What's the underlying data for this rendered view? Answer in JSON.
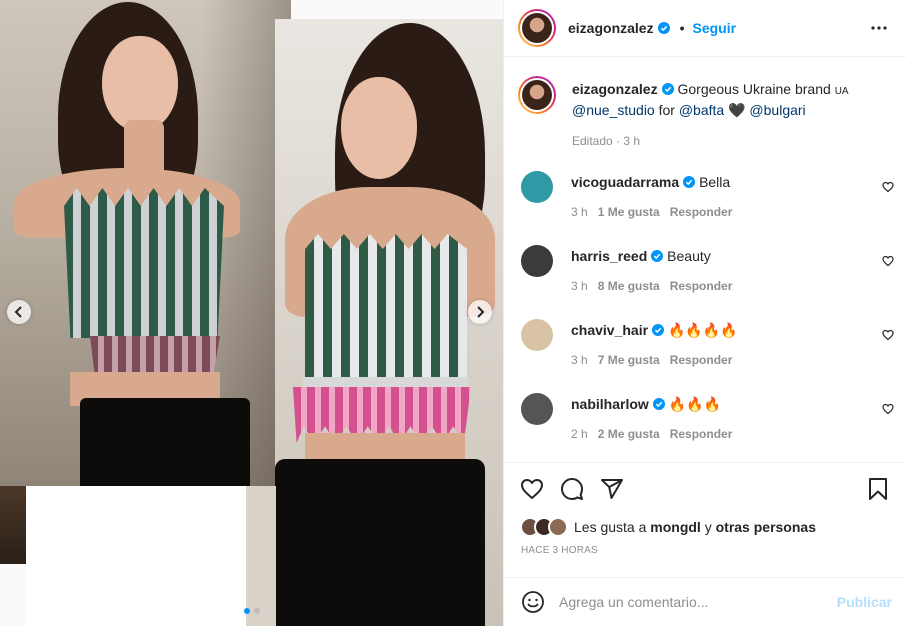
{
  "post": {
    "author": "eizagonzalez",
    "follow_label": "Seguir",
    "separator": "•",
    "more_icon": "more-horizontal-icon"
  },
  "caption": {
    "author": "eizagonzalez",
    "text_1": "Gorgeous Ukraine brand",
    "flag": "UA",
    "mention_1": "@nue_studio",
    "text_2": "for",
    "mention_2": "@bafta",
    "heart": "🖤",
    "mention_3": "@bulgari",
    "meta": "Editado · 3 h"
  },
  "comments": [
    {
      "user": "vicoguadarrama",
      "text": "Bella",
      "time": "3 h",
      "likes": "1 Me gusta",
      "reply": "Responder",
      "avatar_color": "#2f9aa6"
    },
    {
      "user": "harris_reed",
      "text": "Beauty",
      "time": "3 h",
      "likes": "8 Me gusta",
      "reply": "Responder",
      "avatar_color": "#3b3b3b"
    },
    {
      "user": "chaviv_hair",
      "text": "🔥🔥🔥🔥",
      "time": "3 h",
      "likes": "7 Me gusta",
      "reply": "Responder",
      "avatar_color": "#d8c3a5"
    },
    {
      "user": "nabilharlow",
      "text": "🔥🔥🔥",
      "time": "2 h",
      "likes": "2 Me gusta",
      "reply": "Responder",
      "avatar_color": "#555555"
    }
  ],
  "likes": {
    "prefix": "Les gusta a",
    "user": "mongdl",
    "joiner": "y",
    "others": "otras personas"
  },
  "time_ago": "HACE 3 HORAS",
  "add_comment": {
    "placeholder": "Agrega un comentario...",
    "publish_label": "Publicar"
  },
  "carousel": {
    "slides": 2,
    "current": 1
  },
  "colors": {
    "link_blue": "#0095f6",
    "mention_blue": "#00376b",
    "muted": "#8e8e8e",
    "border": "#efefef",
    "publish_disabled": "#b2dffc",
    "verified": "#0095f6"
  }
}
